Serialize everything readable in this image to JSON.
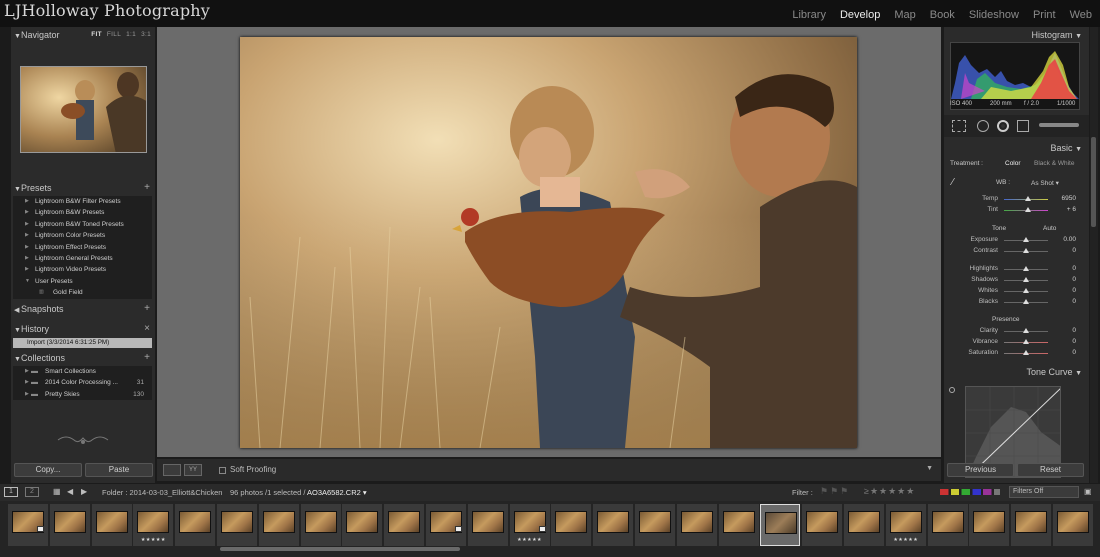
{
  "app": {
    "brand": "LJHolloway Photography",
    "modules": [
      "Library",
      "Develop",
      "Map",
      "Book",
      "Slideshow",
      "Print",
      "Web"
    ],
    "active_module": "Develop"
  },
  "left": {
    "navigator": {
      "title": "Navigator",
      "options": [
        "FIT",
        "FILL",
        "1:1",
        "3:1"
      ],
      "active": "FIT"
    },
    "presets": {
      "title": "Presets",
      "items": [
        "Lightroom B&W Filter Presets",
        "Lightroom B&W Presets",
        "Lightroom B&W Toned Presets",
        "Lightroom Color Presets",
        "Lightroom Effect Presets",
        "Lightroom General Presets",
        "Lightroom Video Presets",
        "User Presets"
      ],
      "sub_items": [
        "Gold Field"
      ]
    },
    "snapshots": {
      "title": "Snapshots"
    },
    "history": {
      "title": "History",
      "items": [
        "Import (3/3/2014 6:31:25 PM)"
      ]
    },
    "collections": {
      "title": "Collections",
      "items": [
        {
          "label": "Smart Collections",
          "count": ""
        },
        {
          "label": "2014 Color Processing ...",
          "count": "31"
        },
        {
          "label": "Pretty Skies",
          "count": "130"
        }
      ]
    },
    "copy_label": "Copy...",
    "paste_label": "Paste"
  },
  "toolbar": {
    "soft_proofing": "Soft Proofing",
    "loupe_label": "YY"
  },
  "right": {
    "histogram": {
      "title": "Histogram",
      "iso": "ISO 400",
      "focal": "200 mm",
      "aperture": "f / 2.0",
      "shutter": "1/1000"
    },
    "basic": {
      "title": "Basic",
      "treatment_label": "Treatment :",
      "treatment_options": [
        "Color",
        "Black & White"
      ],
      "active_treatment": "Color",
      "wb_label": "WB :",
      "wb_value": "As Shot",
      "sliders_wb": [
        {
          "label": "Temp",
          "value": "6950",
          "pos": 0.55
        },
        {
          "label": "Tint",
          "value": "+ 6",
          "pos": 0.55
        }
      ],
      "tone_label": "Tone",
      "auto_label": "Auto",
      "sliders_tone1": [
        {
          "label": "Exposure",
          "value": "0.00",
          "pos": 0.5
        },
        {
          "label": "Contrast",
          "value": "0",
          "pos": 0.5
        }
      ],
      "sliders_tone2": [
        {
          "label": "Highlights",
          "value": "0",
          "pos": 0.5
        },
        {
          "label": "Shadows",
          "value": "0",
          "pos": 0.5
        },
        {
          "label": "Whites",
          "value": "0",
          "pos": 0.5
        },
        {
          "label": "Blacks",
          "value": "0",
          "pos": 0.5
        }
      ],
      "presence_label": "Presence",
      "sliders_presence": [
        {
          "label": "Clarity",
          "value": "0",
          "pos": 0.5
        },
        {
          "label": "Vibrance",
          "value": "0",
          "pos": 0.5
        },
        {
          "label": "Saturation",
          "value": "0",
          "pos": 0.5
        }
      ]
    },
    "tone_curve": {
      "title": "Tone Curve"
    },
    "previous_label": "Previous",
    "reset_label": "Reset"
  },
  "filmbar": {
    "view1": "1",
    "view2": "2",
    "folder": "Folder : 2014-03-03_Elliott&Chicken",
    "count": "96 photos /1 selected /",
    "filename": "AO3A6582.CR2",
    "filter_label": "Filter :",
    "filters_off": "Filters Off"
  },
  "filmstrip": {
    "selected_index": 18,
    "starred": [
      3,
      12,
      21
    ],
    "badged": [
      0,
      10,
      12
    ]
  },
  "colors": {
    "accent": "#ececec",
    "panel": "#2b2b2b",
    "background": "#1b1b1b"
  }
}
